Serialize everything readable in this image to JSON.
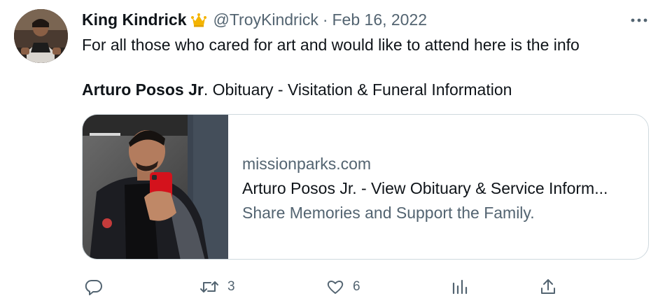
{
  "tweet": {
    "author": {
      "display_name": "King Kindrick",
      "badge_icon": "crown-badge-icon",
      "handle": "@TroyKindrick",
      "separator": "·",
      "date": "Feb 16, 2022"
    },
    "text_line1": "For all those who cared for art and would like to attend here is the info",
    "text_line2_bold": "Arturo Posos Jr",
    "text_line2_rest": ". Obituary - Visitation & Funeral Information",
    "card": {
      "domain": "missionparks.com",
      "title": "Arturo Posos Jr. - View Obituary & Service Inform...",
      "description": "Share Memories and Support the Family."
    },
    "actions": {
      "reply_icon": "reply-icon",
      "retweet_icon": "retweet-icon",
      "retweet_count": "3",
      "like_icon": "heart-icon",
      "like_count": "6",
      "views_icon": "views-icon",
      "share_icon": "share-icon"
    }
  },
  "colors": {
    "text_primary": "#0f1419",
    "text_secondary": "#536471",
    "border": "#cfd9de",
    "badge_gold": "#f4b400"
  }
}
